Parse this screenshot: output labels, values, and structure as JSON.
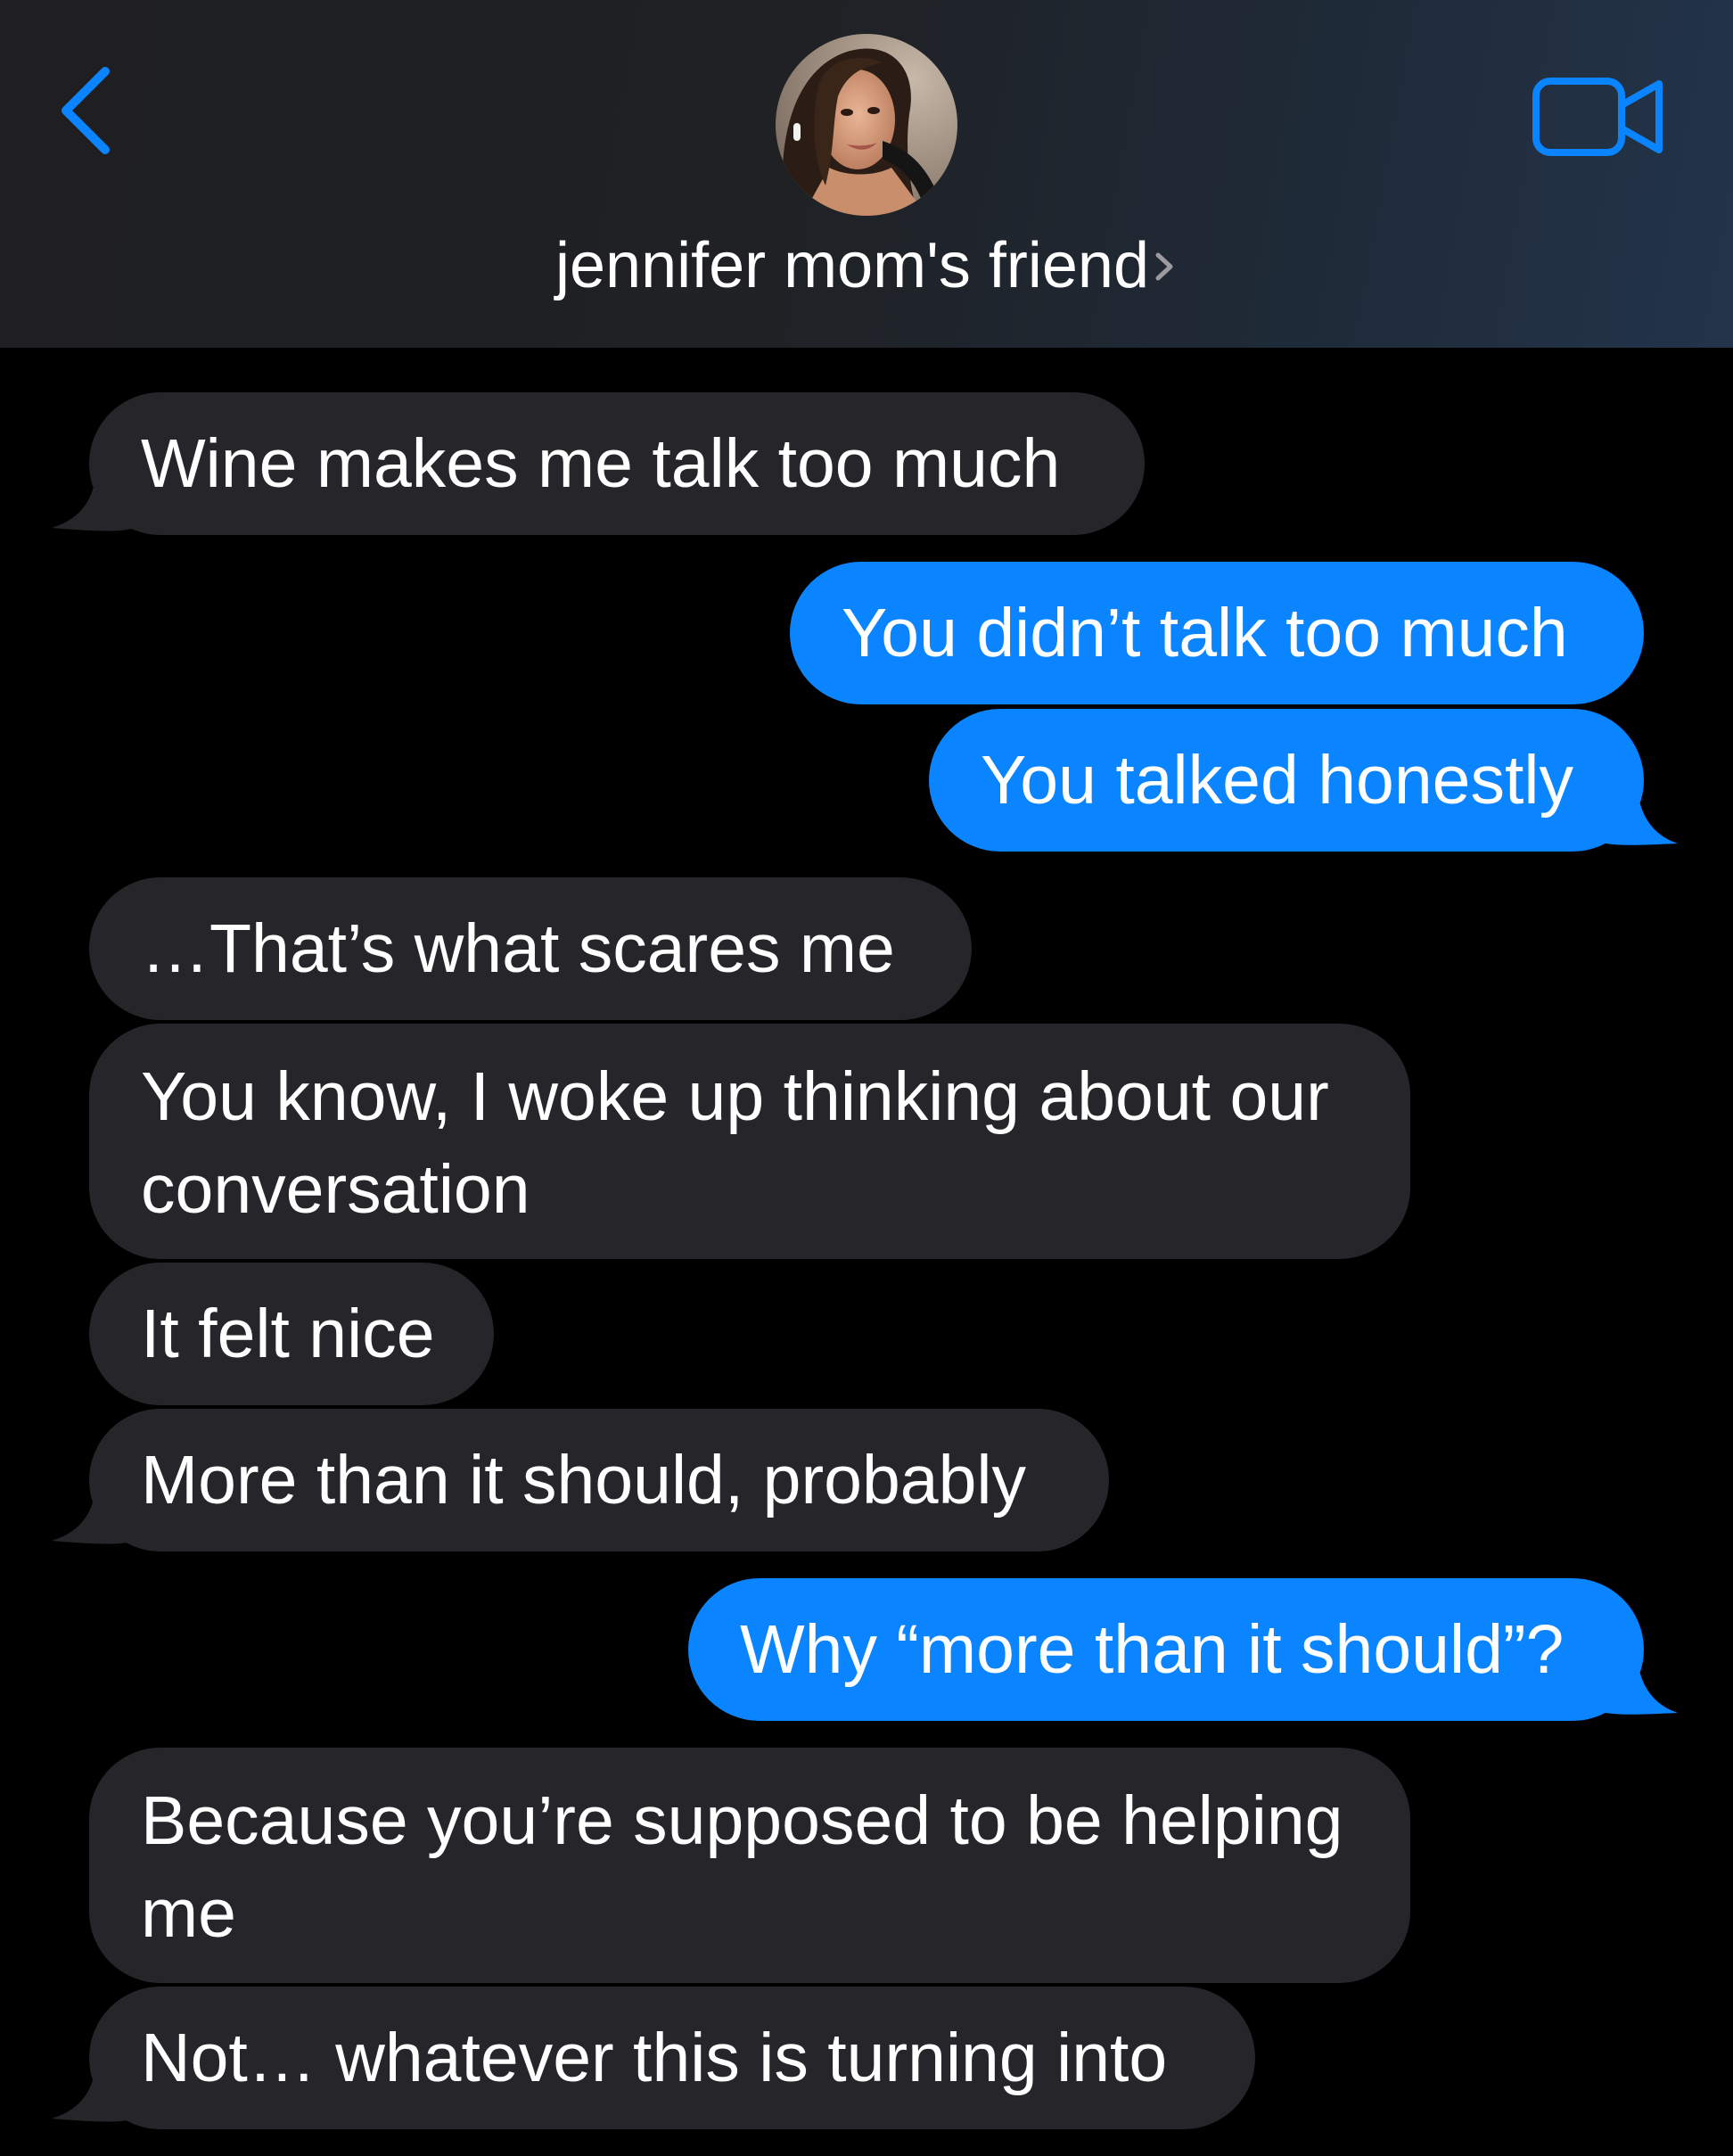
{
  "header": {
    "contact_name": "jennifer mom's friend",
    "back_icon": "chevron-left-icon",
    "video_icon": "video-camera-icon",
    "accent_color": "#0b84ff"
  },
  "messages": [
    {
      "from": "them",
      "text": "Wine makes me talk too much"
    },
    {
      "from": "me",
      "text": "You didn’t talk too much"
    },
    {
      "from": "me",
      "text": "You talked honestly"
    },
    {
      "from": "them",
      "text": "…That’s what scares me"
    },
    {
      "from": "them",
      "text": "You know, I woke up thinking about our conversation"
    },
    {
      "from": "them",
      "text": "It felt nice"
    },
    {
      "from": "them",
      "text": "More than it should, probably"
    },
    {
      "from": "me",
      "text": "Why “more than it should”?"
    },
    {
      "from": "them",
      "text": "Because you’re supposed to be helping me"
    },
    {
      "from": "them",
      "text": "Not… whatever this is turning into"
    }
  ],
  "colors": {
    "received_bubble": "#26262a",
    "sent_bubble": "#0b84ff",
    "background": "#000000"
  }
}
